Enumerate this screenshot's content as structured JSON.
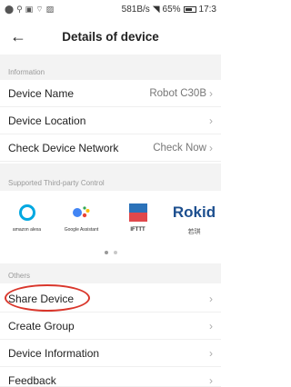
{
  "status_bar": {
    "speed": "581B/s",
    "battery": "65%",
    "time": "17:3"
  },
  "header": {
    "title": "Details of device",
    "back_glyph": "←"
  },
  "information": {
    "heading": "Information",
    "rows": [
      {
        "label": "Device Name",
        "value": "Robot C30B",
        "chevron": "›"
      },
      {
        "label": "Device Location",
        "value": "",
        "chevron": "›"
      },
      {
        "label": "Check Device Network",
        "value": "Check Now",
        "chevron": "›"
      }
    ]
  },
  "third_party": {
    "heading": "Supported Third-party Control",
    "items": [
      {
        "name": "amazon alexa",
        "icon": "alexa-icon"
      },
      {
        "name": "Google Assistant",
        "icon": "google-assistant-icon"
      },
      {
        "name": "IFTTT",
        "icon": "ifttt-icon"
      },
      {
        "name": "Rokid",
        "caption": "若琪",
        "icon": "rokid-icon"
      }
    ],
    "page_dots": 2,
    "active_page": 1
  },
  "others": {
    "heading": "Others",
    "rows": [
      {
        "label": "Share Device",
        "chevron": "›"
      },
      {
        "label": "Create Group",
        "chevron": "›"
      },
      {
        "label": "Device Information",
        "chevron": "›"
      },
      {
        "label": "Feedback",
        "chevron": "›"
      }
    ]
  },
  "colors": {
    "highlight": "#d9362b",
    "alexa": "#00a8e1",
    "rokid": "#1d4f8f"
  }
}
